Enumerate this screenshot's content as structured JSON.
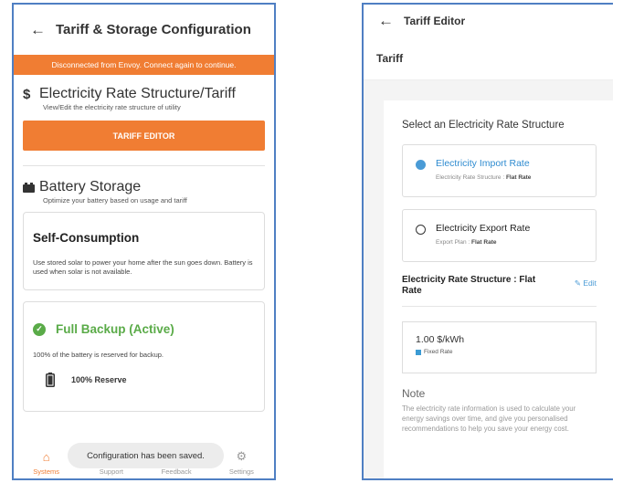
{
  "left": {
    "header": {
      "title": "Tariff & Storage Configuration"
    },
    "banner": "Disconnected from Envoy. Connect again to continue.",
    "rate_section": {
      "icon": "dollar-icon",
      "symbol": "$",
      "title": "Electricity Rate Structure/Tariff",
      "subtitle": "View/Edit the electricity rate structure of utility",
      "button": "TARIFF EDITOR"
    },
    "storage_section": {
      "title": "Battery Storage",
      "subtitle": "Optimize your battery based on usage and tariff",
      "self_consumption": {
        "title": "Self-Consumption",
        "description": "Use stored solar to power your home after the sun goes down. Battery is used when solar is not available."
      },
      "full_backup": {
        "title": "Full Backup (Active)",
        "description": "100% of the battery is reserved for backup.",
        "reserve": "100% Reserve"
      }
    },
    "toast": "Configuration has been saved.",
    "nav": [
      {
        "label": "Systems",
        "icon": "home-icon",
        "active": true
      },
      {
        "label": "Support",
        "icon": "wrench-icon",
        "active": false
      },
      {
        "label": "Feedback",
        "icon": "feedback-icon",
        "active": false
      },
      {
        "label": "Settings",
        "icon": "gear-icon",
        "active": false
      }
    ]
  },
  "right": {
    "header": {
      "title": "Tariff Editor"
    },
    "tab": "Tariff",
    "select_title": "Select an Electricity Rate Structure",
    "options": [
      {
        "label": "Electricity Import Rate",
        "sub_label": "Electricity Rate Structure",
        "sub_value": "Flat Rate",
        "selected": true
      },
      {
        "label": "Electricity Export Rate",
        "sub_label": "Export Plan",
        "sub_value": "Flat Rate",
        "selected": false
      }
    ],
    "structure_title": "Electricity Rate Structure : Flat Rate",
    "edit_label": "Edit",
    "rate": {
      "value": "1.00 $/kWh",
      "type": "Fixed Rate"
    },
    "note": {
      "title": "Note",
      "text": "The electricity rate information is used to calculate your energy savings over time, and give you personalised recommendations to help you save your energy cost."
    }
  },
  "colors": {
    "accent": "#f07d33",
    "active_green": "#5aab48",
    "link_blue": "#4a9bd6",
    "frame": "#4f7fc3"
  }
}
